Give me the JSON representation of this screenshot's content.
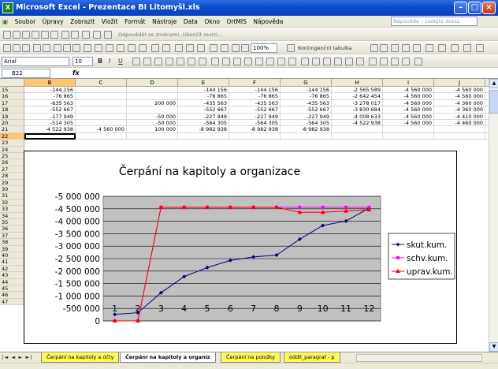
{
  "window": {
    "title": "Microsoft Excel - Prezentace BI Litomyšl.xls",
    "app_icon": "excel-icon"
  },
  "menu": {
    "items": [
      "Soubor",
      "Úpravy",
      "Zobrazit",
      "Vložit",
      "Formát",
      "Nástroje",
      "Data",
      "Okno",
      "OrtMIS",
      "Nápověda"
    ],
    "help_placeholder": "Nápověda – zadejte dotaz"
  },
  "toolbar1": {
    "track_changes": "Odpovědět se změnami...",
    "end_review": "Ukončit revizi..."
  },
  "toolbar2": {
    "zoom": "100%",
    "pivot": "Kontingenční tabulka"
  },
  "toolbar3": {
    "font": "Arial",
    "size": "10",
    "bold": "B",
    "italic": "I",
    "underline": "U"
  },
  "formula_bar": {
    "cell_ref": "B22",
    "fx": "fx",
    "content": ""
  },
  "sheet": {
    "columns": [
      "B",
      "C",
      "D",
      "E",
      "F",
      "G",
      "H",
      "I",
      "J",
      "K"
    ],
    "selected_column": "B",
    "selected_row": "22",
    "rows": [
      {
        "num": "15",
        "cells": [
          "-144 156",
          "",
          "",
          "-144 156",
          "-144 156",
          "-144 156",
          "-2 565 589",
          "-4 560 000",
          "-4 560 000",
          ""
        ]
      },
      {
        "num": "16",
        "cells": [
          "-76 865",
          "",
          "",
          "-76 865",
          "-76 865",
          "-76 865",
          "-2 642 454",
          "-4 560 000",
          "-4 560 000",
          ""
        ]
      },
      {
        "num": "17",
        "cells": [
          "-635 563",
          "",
          "200 000",
          "-435 563",
          "-435 563",
          "-435 563",
          "-3 278 017",
          "-4 560 000",
          "-4 360 000",
          ""
        ]
      },
      {
        "num": "18",
        "cells": [
          "-552 667",
          "",
          "",
          "-552 667",
          "-552 667",
          "-552 667",
          "-3 830 684",
          "-4 560 000",
          "-4 360 000",
          ""
        ]
      },
      {
        "num": "19",
        "cells": [
          "-177 949",
          "",
          "-50 000",
          "-227 949",
          "-227 949",
          "-227 949",
          "-4 008 633",
          "-4 560 000",
          "-4 410 000",
          ""
        ]
      },
      {
        "num": "20",
        "cells": [
          "-514 305",
          "",
          "-50 000",
          "-564 305",
          "-564 305",
          "-564 305",
          "-4 522 938",
          "-4 560 000",
          "-4 460 000",
          ""
        ]
      },
      {
        "num": "21",
        "cells": [
          "-4 522 938",
          "-4 560 000",
          "100 000",
          "-8 982 938",
          "-8 982 938",
          "-8 982 938",
          "",
          "",
          "",
          ""
        ]
      },
      {
        "num": "22",
        "cells": [
          "",
          "",
          "",
          "",
          "",
          "",
          "",
          "",
          "",
          ""
        ]
      }
    ],
    "empty_rows": [
      "23",
      "24",
      "25",
      "26",
      "27",
      "28",
      "29",
      "30",
      "31",
      "32",
      "33",
      "34",
      "35",
      "36",
      "37",
      "38",
      "39",
      "40",
      "41",
      "42",
      "43",
      "44",
      "45",
      "46",
      "47"
    ]
  },
  "chart_data": {
    "type": "line",
    "title": "Čerpání na kapitoly a organizace",
    "categories": [
      "1",
      "2",
      "3",
      "4",
      "5",
      "6",
      "7",
      "8",
      "9",
      "10",
      "11",
      "12"
    ],
    "y_ticks": [
      "-5 000 000",
      "-4 500 000",
      "-4 000 000",
      "-3 500 000",
      "-3 000 000",
      "-2 500 000",
      "-2 000 000",
      "-1 500 000",
      "-1 000 000",
      "-500 000",
      "0"
    ],
    "ylim": [
      -5000000,
      0
    ],
    "y_reversed": true,
    "plot_background": "#c0c0c0",
    "grid": true,
    "legend_position": "right",
    "series": [
      {
        "name": "skut.kum.",
        "color": "#000080",
        "marker": "diamond",
        "values": [
          -260000,
          -330000,
          -1130000,
          -1780000,
          -2140000,
          -2430000,
          -2565589,
          -2642454,
          -3278017,
          -3830684,
          -4008633,
          -4522938
        ]
      },
      {
        "name": "schv.kum.",
        "color": "#ff00ff",
        "marker": "square",
        "values": [
          0,
          0,
          -4560000,
          -4560000,
          -4560000,
          -4560000,
          -4560000,
          -4560000,
          -4560000,
          -4560000,
          -4560000,
          -4560000
        ]
      },
      {
        "name": "uprav.kum.",
        "color": "#ff0000",
        "marker": "triangle",
        "values": [
          0,
          0,
          -4560000,
          -4560000,
          -4560000,
          -4560000,
          -4560000,
          -4560000,
          -4360000,
          -4360000,
          -4410000,
          -4460000
        ]
      }
    ]
  },
  "tabs": {
    "nav": "|◄ ◄ ► ►|",
    "items": [
      "Čerpání na kapitoly a účty",
      "Čerpání na kapitoly a organiz",
      "Čerpání na položky",
      "oddíl_paragraf - p"
    ],
    "active_index": 1
  }
}
